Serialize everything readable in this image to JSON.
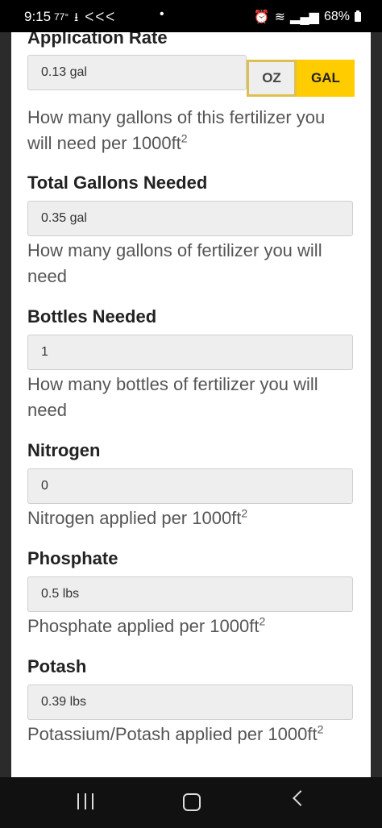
{
  "status_bar": {
    "time": "9:15",
    "temperature": "77°",
    "left_icons": "⭳ ᐸᐸᐸ",
    "dot": "•",
    "battery": "68%"
  },
  "fields": {
    "application_rate": {
      "label": "Application Rate",
      "value": "0.13 gal",
      "help": "How many gallons of this fertilizer you will need per 1000ft",
      "help_sup": "2",
      "units": {
        "oz": "OZ",
        "gal": "GAL",
        "selected": "GAL"
      }
    },
    "total_gallons": {
      "label": "Total Gallons Needed",
      "value": "0.35 gal",
      "help": "How many gallons of fertilizer you will need"
    },
    "bottles": {
      "label": "Bottles Needed",
      "value": "1",
      "help": "How many bottles of fertilizer you will need"
    },
    "nitrogen": {
      "label": "Nitrogen",
      "value": "0",
      "help": "Nitrogen applied per 1000ft",
      "help_sup": "2"
    },
    "phosphate": {
      "label": "Phosphate",
      "value": "0.5 lbs",
      "help": "Phosphate applied per 1000ft",
      "help_sup": "2"
    },
    "potash": {
      "label": "Potash",
      "value": "0.39 lbs",
      "help": "Potassium/Potash applied per 1000ft",
      "help_sup": "2"
    }
  },
  "colors": {
    "accent": "#ffcc00",
    "input_bg": "#eeeeee",
    "label": "#222222",
    "help": "#555555"
  }
}
